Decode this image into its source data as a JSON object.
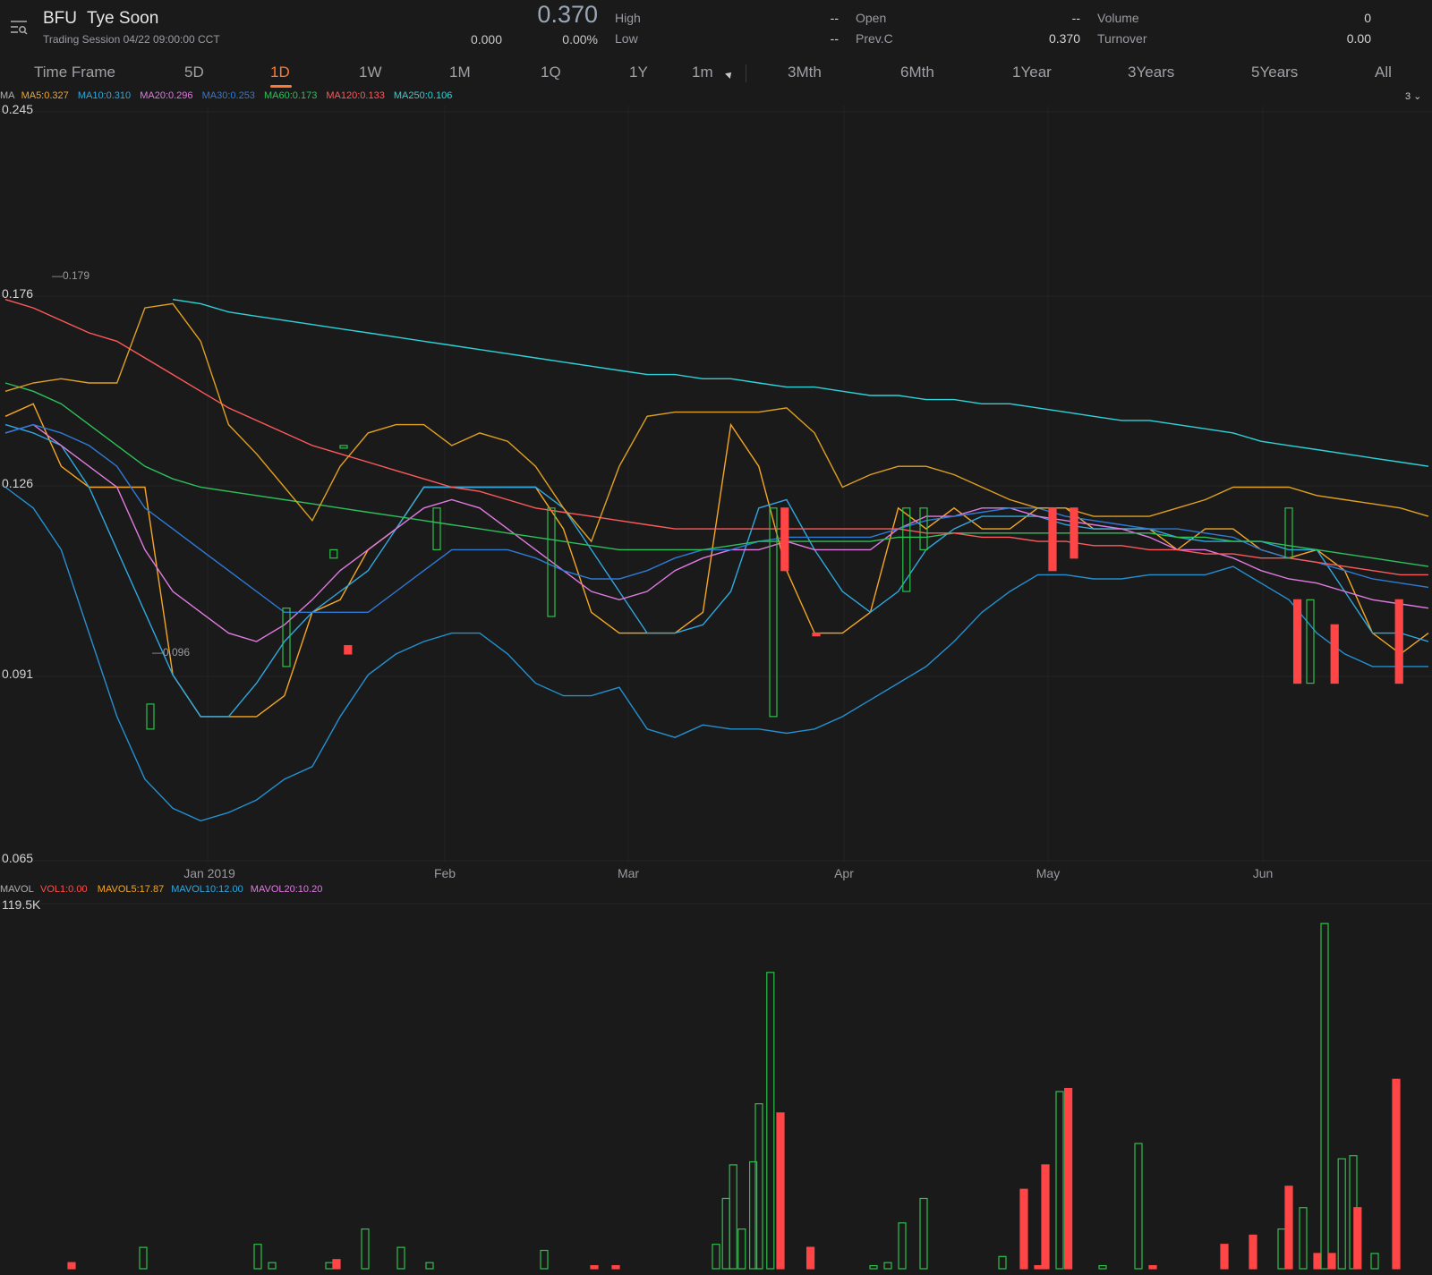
{
  "header": {
    "symbol": "BFU",
    "name": "Tye Soon",
    "session": "Trading Session  04/22 09:00:00 CCT",
    "price": "0.370",
    "change": "0.000",
    "change_pct": "0.00%",
    "stats": [
      {
        "label": "High",
        "value": "--"
      },
      {
        "label": "Low",
        "value": "--"
      },
      {
        "label": "Open",
        "value": "--"
      },
      {
        "label": "Prev.C",
        "value": "0.370"
      },
      {
        "label": "Volume",
        "value": "0"
      },
      {
        "label": "Turnover",
        "value": "0.00"
      }
    ]
  },
  "tabs": [
    "Time Frame",
    "5D",
    "1D",
    "1W",
    "1M",
    "1Q",
    "1Y",
    "1m",
    "3Mth",
    "6Mth",
    "1Year",
    "3Years",
    "5Years",
    "All"
  ],
  "active_tab": "1D",
  "ma_legend": {
    "prefix": "MA",
    "items": [
      {
        "text": "MA5:0.327",
        "color": "#f5a623"
      },
      {
        "text": "MA10:0.310",
        "color": "#2fa8e0"
      },
      {
        "text": "MA20:0.296",
        "color": "#e07be0"
      },
      {
        "text": "MA30:0.253",
        "color": "#2e7bd6"
      },
      {
        "text": "MA60:0.173",
        "color": "#2cc15a"
      },
      {
        "text": "MA120:0.133",
        "color": "#ff5a5a"
      },
      {
        "text": "MA250:0.106",
        "color": "#2ed3d8"
      }
    ],
    "right": "3 ⌄"
  },
  "vol_legend": {
    "prefix": "MAVOL",
    "items": [
      {
        "text": "VOL1:0.00",
        "color": "#ff4d4d"
      },
      {
        "text": "MAVOL5:17.87",
        "color": "#f5a623"
      },
      {
        "text": "MAVOL10:12.00",
        "color": "#2fa8e0"
      },
      {
        "text": "MAVOL20:10.20",
        "color": "#e07be0"
      }
    ]
  },
  "colors": {
    "up": "#ff4545",
    "down": "#2cc14a",
    "accent": "#ff7a2f",
    "background": "#1a1a1b"
  },
  "chart_data": [
    {
      "type": "line",
      "y_axis_labels": [
        "0.245",
        "0.176",
        "0.126",
        "0.091",
        "0.065"
      ],
      "x_axis_labels": [
        "Jan 2019",
        "Feb",
        "Mar",
        "Apr",
        "May",
        "Jun"
      ],
      "ylim": [
        0.065,
        0.245
      ],
      "annotations": [
        {
          "text": "0.179",
          "kind": "high"
        },
        {
          "text": "0.096",
          "kind": "low"
        }
      ],
      "series": [
        {
          "name": "MA5",
          "color": "#f5a623",
          "values": [
            0.172,
            0.175,
            0.16,
            0.155,
            0.155,
            0.155,
            0.11,
            0.1,
            0.1,
            0.1,
            0.105,
            0.125,
            0.128,
            0.14,
            0.145,
            0.155,
            0.155,
            0.155,
            0.155,
            0.155,
            0.145,
            0.125,
            0.12,
            0.12,
            0.12,
            0.125,
            0.17,
            0.16,
            0.135,
            0.12,
            0.12,
            0.125,
            0.15,
            0.145,
            0.15,
            0.145,
            0.145,
            0.15,
            0.15,
            0.145,
            0.145,
            0.145,
            0.14,
            0.145,
            0.145,
            0.14,
            0.138,
            0.14,
            0.135,
            0.12,
            0.115,
            0.12
          ]
        },
        {
          "name": "MA10",
          "color": "#2fa8e0",
          "values": [
            0.17,
            0.168,
            0.165,
            0.155,
            0.14,
            0.125,
            0.11,
            0.1,
            0.1,
            0.108,
            0.118,
            0.125,
            0.13,
            0.135,
            0.145,
            0.155,
            0.155,
            0.155,
            0.155,
            0.155,
            0.15,
            0.14,
            0.13,
            0.12,
            0.12,
            0.122,
            0.13,
            0.15,
            0.152,
            0.14,
            0.13,
            0.125,
            0.13,
            0.14,
            0.145,
            0.148,
            0.148,
            0.148,
            0.146,
            0.145,
            0.145,
            0.145,
            0.143,
            0.142,
            0.142,
            0.142,
            0.14,
            0.14,
            0.13,
            0.12,
            0.12,
            0.118
          ]
        },
        {
          "name": "MA20",
          "color": "#e07be0",
          "values": [
            0.168,
            0.17,
            0.165,
            0.16,
            0.155,
            0.14,
            0.13,
            0.125,
            0.12,
            0.118,
            0.122,
            0.128,
            0.135,
            0.14,
            0.145,
            0.15,
            0.152,
            0.15,
            0.145,
            0.14,
            0.135,
            0.13,
            0.128,
            0.13,
            0.135,
            0.138,
            0.14,
            0.14,
            0.142,
            0.14,
            0.14,
            0.14,
            0.145,
            0.148,
            0.148,
            0.15,
            0.15,
            0.148,
            0.147,
            0.146,
            0.145,
            0.143,
            0.14,
            0.14,
            0.138,
            0.135,
            0.133,
            0.132,
            0.13,
            0.128,
            0.127,
            0.126
          ]
        },
        {
          "name": "MA30",
          "color": "#2e7bd6",
          "values": [
            0.168,
            0.17,
            0.168,
            0.165,
            0.16,
            0.15,
            0.145,
            0.14,
            0.135,
            0.13,
            0.125,
            0.125,
            0.125,
            0.125,
            0.13,
            0.135,
            0.14,
            0.14,
            0.14,
            0.138,
            0.135,
            0.133,
            0.133,
            0.135,
            0.138,
            0.14,
            0.14,
            0.142,
            0.143,
            0.143,
            0.143,
            0.143,
            0.145,
            0.147,
            0.148,
            0.149,
            0.15,
            0.15,
            0.148,
            0.147,
            0.146,
            0.145,
            0.145,
            0.144,
            0.143,
            0.14,
            0.138,
            0.137,
            0.135,
            0.133,
            0.132,
            0.131
          ]
        },
        {
          "name": "MA60",
          "color": "#2cc15a",
          "values": [
            0.18,
            0.178,
            0.175,
            0.17,
            0.165,
            0.16,
            0.157,
            0.155,
            0.154,
            0.153,
            0.152,
            0.151,
            0.15,
            0.149,
            0.148,
            0.147,
            0.146,
            0.145,
            0.144,
            0.143,
            0.142,
            0.141,
            0.14,
            0.14,
            0.14,
            0.14,
            0.141,
            0.142,
            0.142,
            0.142,
            0.142,
            0.142,
            0.143,
            0.143,
            0.144,
            0.144,
            0.144,
            0.144,
            0.144,
            0.144,
            0.144,
            0.144,
            0.143,
            0.143,
            0.142,
            0.142,
            0.141,
            0.14,
            0.139,
            0.138,
            0.137,
            0.136
          ]
        },
        {
          "name": "MA120",
          "color": "#ff5a5a",
          "values": [
            0.2,
            0.198,
            0.195,
            0.192,
            0.19,
            0.186,
            0.182,
            0.178,
            0.174,
            0.171,
            0.168,
            0.165,
            0.163,
            0.161,
            0.159,
            0.157,
            0.155,
            0.154,
            0.152,
            0.15,
            0.149,
            0.148,
            0.147,
            0.146,
            0.145,
            0.145,
            0.145,
            0.145,
            0.145,
            0.145,
            0.145,
            0.145,
            0.145,
            0.144,
            0.144,
            0.143,
            0.143,
            0.142,
            0.142,
            0.141,
            0.141,
            0.14,
            0.14,
            0.139,
            0.139,
            0.138,
            0.138,
            0.137,
            0.136,
            0.135,
            0.134,
            0.134
          ]
        },
        {
          "name": "MA250",
          "color": "#2ed3d8",
          "values": [
            null,
            null,
            null,
            null,
            null,
            null,
            0.2,
            0.199,
            0.197,
            0.196,
            0.195,
            0.194,
            0.193,
            0.192,
            0.191,
            0.19,
            0.189,
            0.188,
            0.187,
            0.186,
            0.185,
            0.184,
            0.183,
            0.182,
            0.182,
            0.181,
            0.181,
            0.18,
            0.179,
            0.179,
            0.178,
            0.177,
            0.177,
            0.176,
            0.176,
            0.175,
            0.175,
            0.174,
            0.173,
            0.172,
            0.171,
            0.171,
            0.17,
            0.169,
            0.168,
            0.166,
            0.165,
            0.164,
            0.163,
            0.162,
            0.161,
            0.16
          ]
        },
        {
          "name": "BOLL-UP",
          "color": "#e0a020",
          "values": [
            0.178,
            0.18,
            0.181,
            0.18,
            0.18,
            0.198,
            0.199,
            0.19,
            0.17,
            0.163,
            0.155,
            0.147,
            0.16,
            0.168,
            0.17,
            0.17,
            0.165,
            0.168,
            0.166,
            0.16,
            0.15,
            0.142,
            0.16,
            0.172,
            0.173,
            0.173,
            0.173,
            0.173,
            0.174,
            0.168,
            0.155,
            0.158,
            0.16,
            0.16,
            0.158,
            0.155,
            0.152,
            0.15,
            0.15,
            0.148,
            0.148,
            0.148,
            0.15,
            0.152,
            0.155,
            0.155,
            0.155,
            0.153,
            0.152,
            0.151,
            0.15,
            0.148
          ]
        },
        {
          "name": "BOLL-LOW",
          "color": "#2390d0",
          "values": [
            0.155,
            0.15,
            0.14,
            0.12,
            0.1,
            0.085,
            0.078,
            0.075,
            0.077,
            0.08,
            0.085,
            0.088,
            0.1,
            0.11,
            0.115,
            0.118,
            0.12,
            0.12,
            0.115,
            0.108,
            0.105,
            0.105,
            0.107,
            0.097,
            0.095,
            0.098,
            0.097,
            0.097,
            0.096,
            0.097,
            0.1,
            0.104,
            0.108,
            0.112,
            0.118,
            0.125,
            0.13,
            0.134,
            0.134,
            0.133,
            0.133,
            0.134,
            0.134,
            0.134,
            0.136,
            0.132,
            0.128,
            0.12,
            0.115,
            0.112,
            0.112,
            0.112
          ]
        }
      ]
    },
    {
      "type": "bar",
      "y_axis_labels": [
        "119.5K"
      ],
      "ylim": [
        0,
        119.5
      ],
      "bars": [
        {
          "x": 0.05,
          "value": 2,
          "dir": "up"
        },
        {
          "x": 0.1,
          "value": 7,
          "dir": "down"
        },
        {
          "x": 0.18,
          "value": 8,
          "dir": "down"
        },
        {
          "x": 0.19,
          "value": 2,
          "dir": "down"
        },
        {
          "x": 0.23,
          "value": 2,
          "dir": "down"
        },
        {
          "x": 0.235,
          "value": 3,
          "dir": "up"
        },
        {
          "x": 0.255,
          "value": 13,
          "dir": "down"
        },
        {
          "x": 0.28,
          "value": 7,
          "dir": "down"
        },
        {
          "x": 0.3,
          "value": 2,
          "dir": "down"
        },
        {
          "x": 0.38,
          "value": 6,
          "dir": "down"
        },
        {
          "x": 0.415,
          "value": 1,
          "dir": "up"
        },
        {
          "x": 0.43,
          "value": 1,
          "dir": "up"
        },
        {
          "x": 0.5,
          "value": 8,
          "dir": "down"
        },
        {
          "x": 0.507,
          "value": 23,
          "dir": "down"
        },
        {
          "x": 0.512,
          "value": 34,
          "dir": "down"
        },
        {
          "x": 0.518,
          "value": 13,
          "dir": "down"
        },
        {
          "x": 0.526,
          "value": 35,
          "dir": "down"
        },
        {
          "x": 0.53,
          "value": 54,
          "dir": "down"
        },
        {
          "x": 0.538,
          "value": 97,
          "dir": "down"
        },
        {
          "x": 0.545,
          "value": 51,
          "dir": "up"
        },
        {
          "x": 0.566,
          "value": 7,
          "dir": "up"
        },
        {
          "x": 0.61,
          "value": 1,
          "dir": "down"
        },
        {
          "x": 0.62,
          "value": 2,
          "dir": "down"
        },
        {
          "x": 0.63,
          "value": 15,
          "dir": "down"
        },
        {
          "x": 0.645,
          "value": 23,
          "dir": "down"
        },
        {
          "x": 0.7,
          "value": 4,
          "dir": "down"
        },
        {
          "x": 0.715,
          "value": 26,
          "dir": "up"
        },
        {
          "x": 0.725,
          "value": 1,
          "dir": "up"
        },
        {
          "x": 0.73,
          "value": 34,
          "dir": "up"
        },
        {
          "x": 0.74,
          "value": 58,
          "dir": "down"
        },
        {
          "x": 0.746,
          "value": 59,
          "dir": "up"
        },
        {
          "x": 0.77,
          "value": 1,
          "dir": "down"
        },
        {
          "x": 0.795,
          "value": 41,
          "dir": "down"
        },
        {
          "x": 0.805,
          "value": 1,
          "dir": "up"
        },
        {
          "x": 0.855,
          "value": 8,
          "dir": "up"
        },
        {
          "x": 0.875,
          "value": 11,
          "dir": "up"
        },
        {
          "x": 0.895,
          "value": 13,
          "dir": "down"
        },
        {
          "x": 0.9,
          "value": 27,
          "dir": "up"
        },
        {
          "x": 0.91,
          "value": 20,
          "dir": "down"
        },
        {
          "x": 0.92,
          "value": 5,
          "dir": "up"
        },
        {
          "x": 0.925,
          "value": 113,
          "dir": "down"
        },
        {
          "x": 0.93,
          "value": 5,
          "dir": "up"
        },
        {
          "x": 0.937,
          "value": 36,
          "dir": "down"
        },
        {
          "x": 0.945,
          "value": 37,
          "dir": "down"
        },
        {
          "x": 0.948,
          "value": 20,
          "dir": "up"
        },
        {
          "x": 0.96,
          "value": 5,
          "dir": "down"
        },
        {
          "x": 0.975,
          "value": 62,
          "dir": "up"
        }
      ]
    }
  ]
}
